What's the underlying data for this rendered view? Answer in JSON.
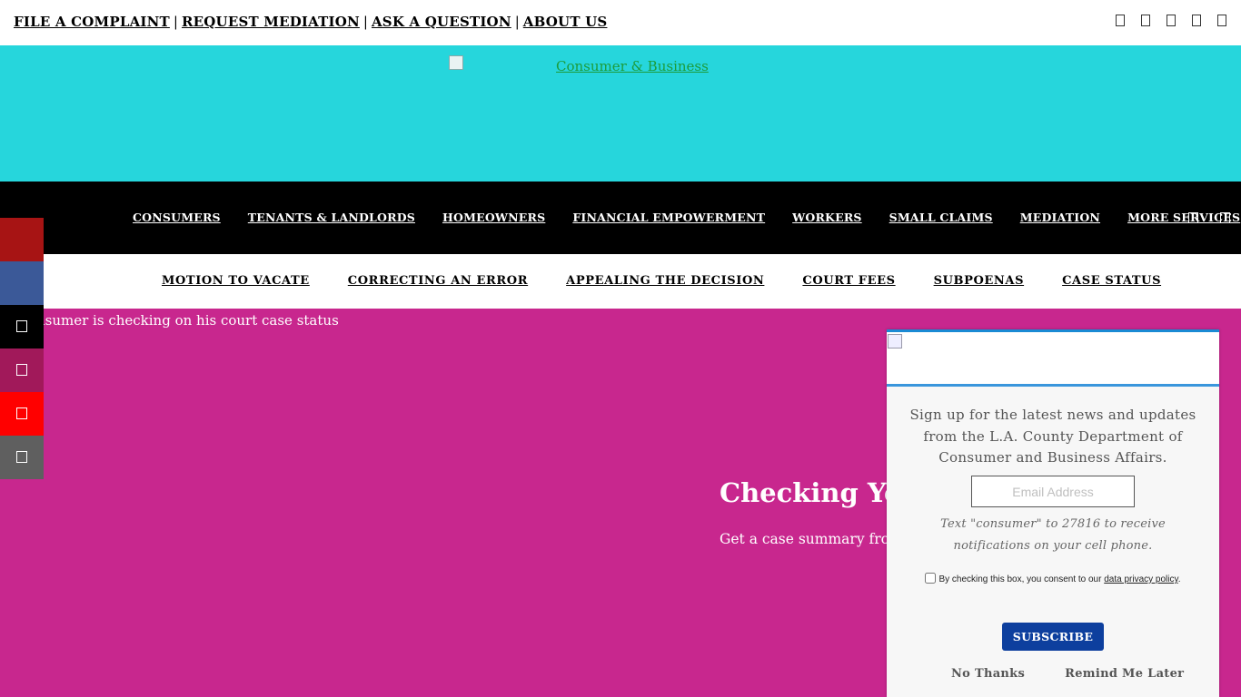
{
  "topbar": {
    "links": [
      "FILE A COMPLAINT",
      "REQUEST MEDIATION",
      "ASK A QUESTION",
      "ABOUT US"
    ],
    "separator": "|",
    "icons": [
      "phone-icon",
      "email-icon",
      "location-icon",
      "language-icon",
      "accessibility-icon"
    ]
  },
  "banner": {
    "logo_alt": "Consumer & Business",
    "background": "#26d6dc"
  },
  "main_nav": {
    "items": [
      "CONSUMERS",
      "TENANTS & LANDLORDS",
      "HOMEOWNERS",
      "FINANCIAL EMPOWERMENT",
      "WORKERS",
      "SMALL CLAIMS",
      "MEDIATION",
      "MORE SERVICES"
    ],
    "icons": [
      "search-icon",
      "menu-icon"
    ]
  },
  "sub_nav": {
    "items": [
      "MOTION TO VACATE",
      "CORRECTING AN ERROR",
      "APPEALING THE DECISION",
      "COURT FEES",
      "SUBPOENAS",
      "CASE STATUS"
    ]
  },
  "hero": {
    "image_caption": "nsumer is checking on his court case status",
    "title": "Checking Your",
    "subtitle": "Get a case summary from",
    "background": "#c8278e"
  },
  "social_bar": {
    "buttons": [
      {
        "icon": "share-icon",
        "color": "#a71414"
      },
      {
        "icon": "facebook-icon",
        "color": "#3b5998"
      },
      {
        "icon": "twitter-icon",
        "color": "#000000"
      },
      {
        "icon": "instagram-icon",
        "color": "#a1195a"
      },
      {
        "icon": "youtube-icon",
        "color": "#ff0000"
      },
      {
        "icon": "email-share-icon",
        "color": "#5f5f5f"
      }
    ]
  },
  "signup_popup": {
    "description": "Sign up for the latest news and updates from the L.A. County Department of Consumer and Business Affairs.",
    "email_placeholder": "Email Address",
    "sms_text": "Text \"consumer\" to 27816 to receive notifications on your cell phone.",
    "consent_text": "By checking this box, you consent to our ",
    "consent_link": "data privacy policy",
    "consent_end": ".",
    "subscribe_label": "SUBSCRIBE",
    "no_thanks": "No Thanks",
    "remind_later": "Remind Me Later",
    "accent_color": "#1a8ad4",
    "button_color": "#0d3f9e"
  }
}
